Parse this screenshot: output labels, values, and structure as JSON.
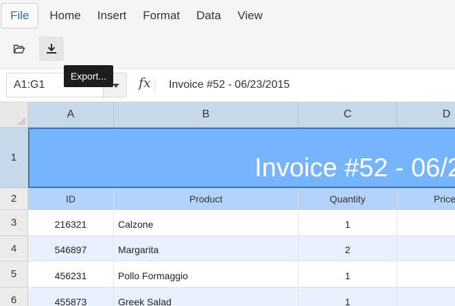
{
  "menu": {
    "items": [
      {
        "label": "File",
        "active": true
      },
      {
        "label": "Home",
        "active": false
      },
      {
        "label": "Insert",
        "active": false
      },
      {
        "label": "Format",
        "active": false
      },
      {
        "label": "Data",
        "active": false
      },
      {
        "label": "View",
        "active": false
      }
    ]
  },
  "toolbar": {
    "open_icon": "folder-open-icon",
    "export_icon": "download-icon",
    "tooltip": "Export..."
  },
  "formula_bar": {
    "name_box": "A1:G1",
    "fx": "fx",
    "formula": "Invoice #52 - 06/23/2015"
  },
  "sheet": {
    "column_headers": [
      "A",
      "B",
      "C",
      "D"
    ],
    "row_headers": [
      "1",
      "2",
      "3",
      "4",
      "5",
      "6"
    ],
    "title": "Invoice #52 - 06/23/2015",
    "table_headers": [
      "ID",
      "Product",
      "Quantity",
      "Price"
    ],
    "rows": [
      {
        "id": "216321",
        "product": "Calzone",
        "quantity": "1"
      },
      {
        "id": "546897",
        "product": "Margarita",
        "quantity": "2"
      },
      {
        "id": "456231",
        "product": "Pollo Formaggio",
        "quantity": "1"
      },
      {
        "id": "455873",
        "product": "Greek Salad",
        "quantity": "1"
      }
    ]
  },
  "colors": {
    "title_fill": "#76b5fe",
    "header_fill": "#b3d3fa",
    "alt_row_fill": "#e8f1fd",
    "column_header_fill": "#c7d8ea",
    "accent": "#2a6ab8"
  }
}
